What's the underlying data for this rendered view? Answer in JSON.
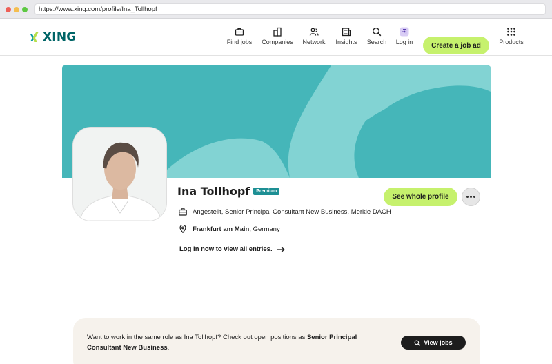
{
  "browser": {
    "url": "https://www.xing.com/profile/Ina_Tollhopf"
  },
  "header": {
    "logo_text": "XING",
    "nav": [
      {
        "label": "Find jobs",
        "icon": "briefcase-icon"
      },
      {
        "label": "Companies",
        "icon": "building-icon"
      },
      {
        "label": "Network",
        "icon": "people-icon"
      },
      {
        "label": "Insights",
        "icon": "newspaper-icon"
      },
      {
        "label": "Search",
        "icon": "search-icon"
      },
      {
        "label": "Log in",
        "icon": "login-icon"
      }
    ],
    "cta_label": "Create a job ad",
    "products_label": "Products"
  },
  "profile": {
    "name": "Ina Tollhopf",
    "badge": "Premium",
    "occupation": "Angestellt, Senior Principal Consultant New Business, Merkle DACH",
    "city": "Frankfurt am Main",
    "country": ", Germany",
    "login_prompt": "Log in now to view all entries.",
    "see_profile_label": "See whole profile"
  },
  "jobs_banner": {
    "text_before": "Want to work in the same role as Ina Tollhopf? Check out open positions as ",
    "role": "Senior Principal Consultant New Business",
    "text_after": ".",
    "button_label": "View jobs"
  },
  "colors": {
    "accent_green": "#c6f16d",
    "brand_teal": "#006567",
    "cover_teal": "#45b6b9",
    "premium_badge": "#1d8f94"
  }
}
